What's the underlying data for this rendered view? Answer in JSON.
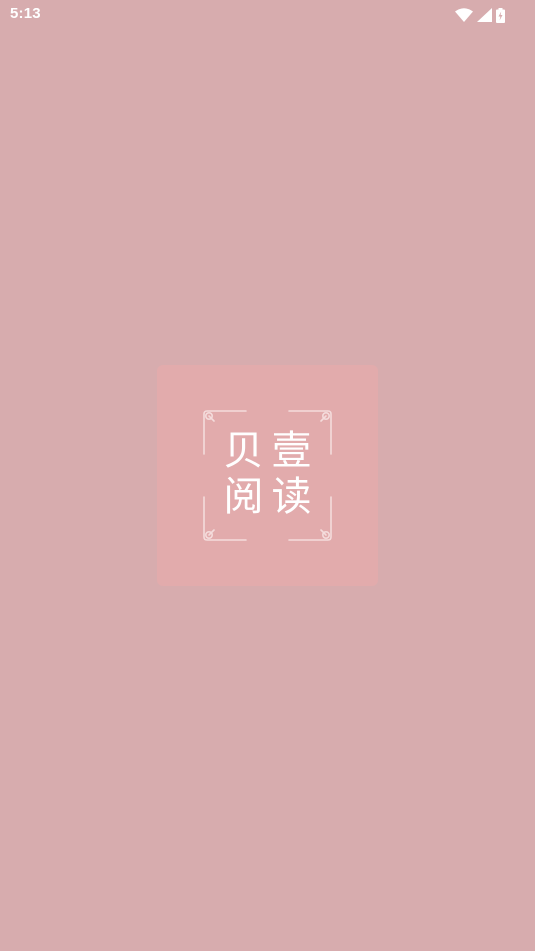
{
  "status_bar": {
    "time": "5:13",
    "icons": [
      "wifi-icon",
      "cellular-signal-icon",
      "battery-charging-icon"
    ]
  },
  "splash": {
    "logo_line_1": "贝壹",
    "logo_line_2": "阅读"
  },
  "colors": {
    "background": "#d7acae",
    "logo_card": "#e2abac",
    "logo_text": "#ffffff"
  }
}
